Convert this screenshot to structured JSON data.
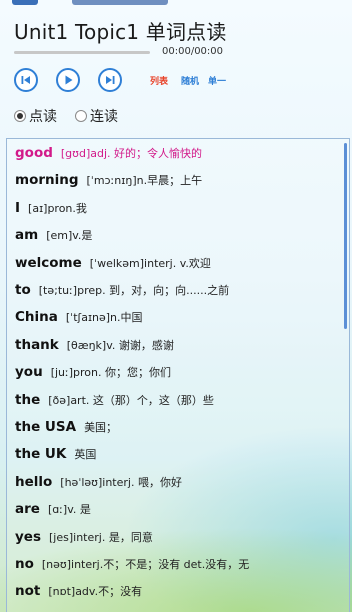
{
  "header": {
    "title": "Unit1 Topic1 单词点读"
  },
  "player": {
    "time": "00:00/00:00",
    "modes": [
      {
        "label": "列表",
        "color": "#e8432a"
      },
      {
        "label": "随机",
        "color": "#2f7fd6"
      },
      {
        "label": "单一",
        "color": "#2f7fd6"
      }
    ],
    "progress": 0
  },
  "read_mode": {
    "options": [
      "点读",
      "连读"
    ],
    "selected": "点读"
  },
  "words": [
    {
      "word": "good",
      "def": "[gʊd]adj. 好的；令人愉快的",
      "active": true
    },
    {
      "word": "morning",
      "def": "[ˈmɔːnɪŋ]n.早晨；上午"
    },
    {
      "word": "I",
      "def": "[aɪ]pron.我"
    },
    {
      "word": "am",
      "def": "[em]v.是"
    },
    {
      "word": "welcome",
      "def": "[ˈwelkəm]interj. v.欢迎"
    },
    {
      "word": "to",
      "def": "[tə;tuː]prep. 到，对，向；向......之前"
    },
    {
      "word": "China",
      "def": "[ˈtʃaɪnə]n.中国"
    },
    {
      "word": "thank",
      "def": "[θæŋk]v. 谢谢，感谢"
    },
    {
      "word": "you",
      "def": "[juː]pron. 你；您；你们"
    },
    {
      "word": "the",
      "def": "[ðə]art. 这（那）个，这（那）些"
    },
    {
      "word": "the USA",
      "def": "美国；"
    },
    {
      "word": "the UK",
      "def": "英国"
    },
    {
      "word": "hello",
      "def": "[həˈləʊ]interj. 喂，你好"
    },
    {
      "word": "are",
      "def": "[ɑː]v. 是"
    },
    {
      "word": "yes",
      "def": "[jes]interj. 是，同意"
    },
    {
      "word": "no",
      "def": "[nəʊ]interj.不；不是；没有 det.没有，无"
    },
    {
      "word": "not",
      "def": "[nɒt]adv.不；没有"
    }
  ]
}
